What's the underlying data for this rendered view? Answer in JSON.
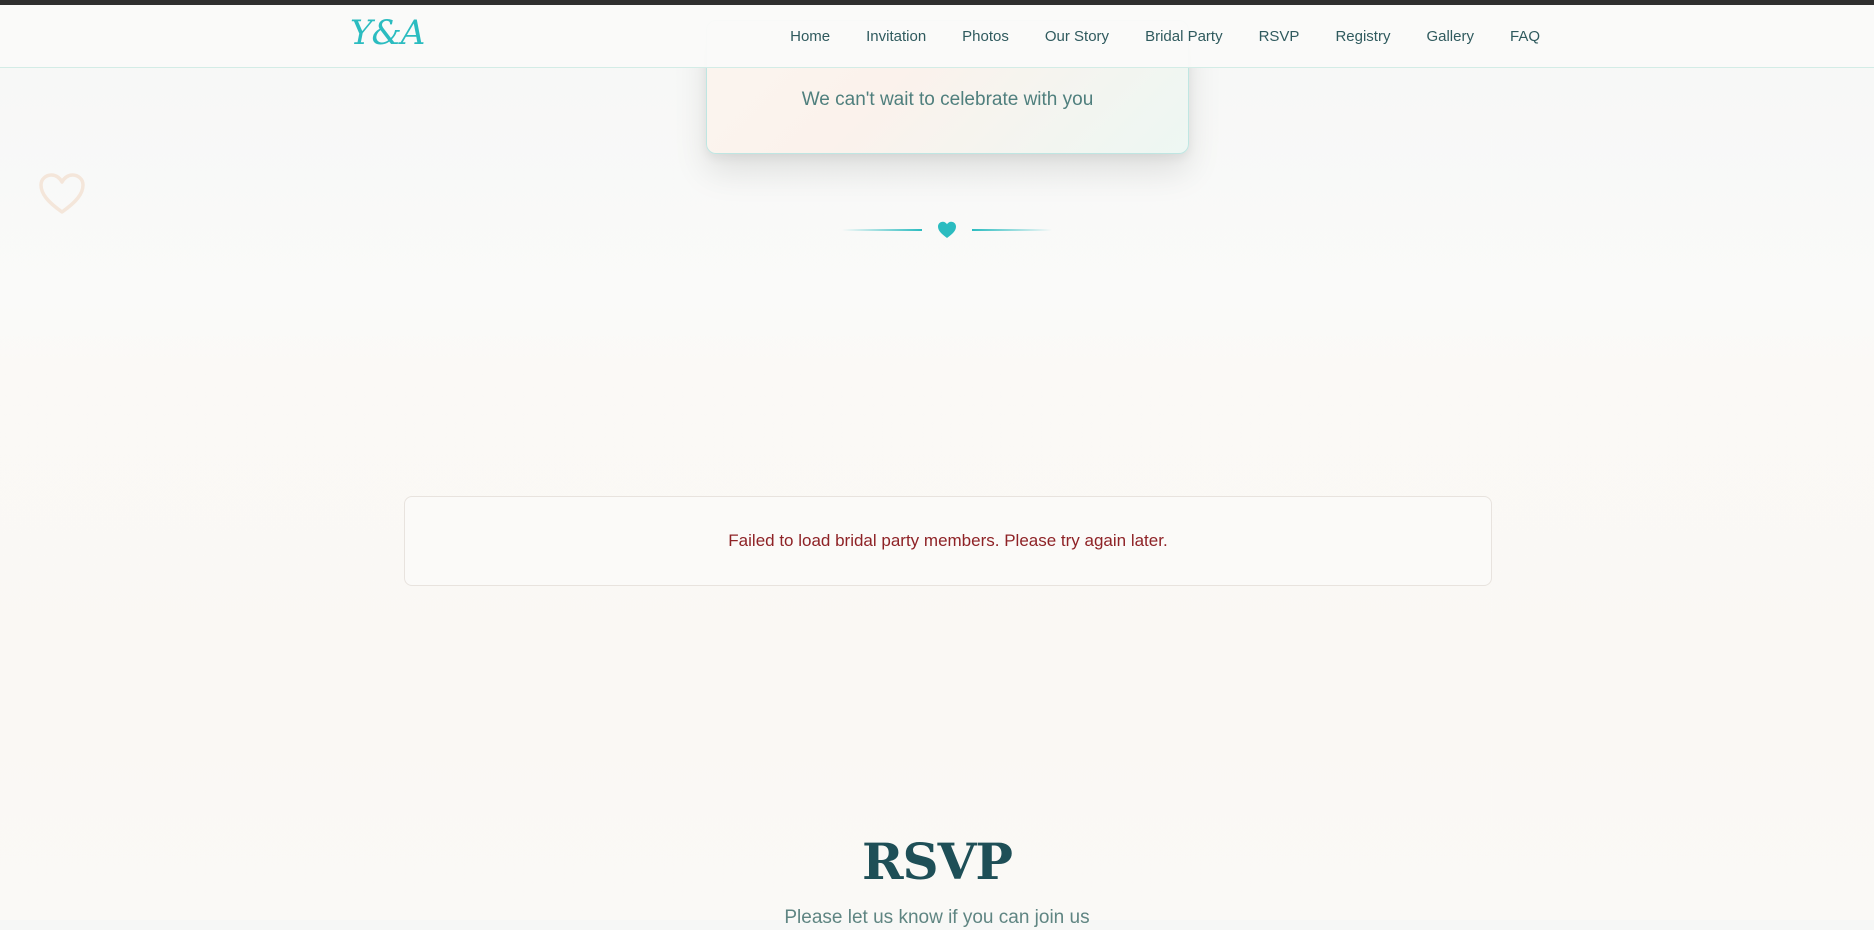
{
  "navbar": {
    "brand": "Y&A",
    "links": [
      {
        "label": "Home"
      },
      {
        "label": "Invitation"
      },
      {
        "label": "Photos"
      },
      {
        "label": "Our Story"
      },
      {
        "label": "Bridal Party"
      },
      {
        "label": "RSVP"
      },
      {
        "label": "Registry"
      },
      {
        "label": "Gallery"
      },
      {
        "label": "FAQ"
      }
    ]
  },
  "hero": {
    "subtitle": "We can't wait to celebrate with you"
  },
  "divider": {
    "icon": "heart-icon"
  },
  "bridal_party": {
    "error_message": "Failed to load bridal party members. Please try again later."
  },
  "rsvp": {
    "heading": "RSVP",
    "subtitle": "Please let us know if you can join us"
  },
  "colors": {
    "accent": "#2bbcc0",
    "heading": "#1e4f57",
    "error": "#8e2226",
    "nav_text": "#2f5a5e"
  }
}
